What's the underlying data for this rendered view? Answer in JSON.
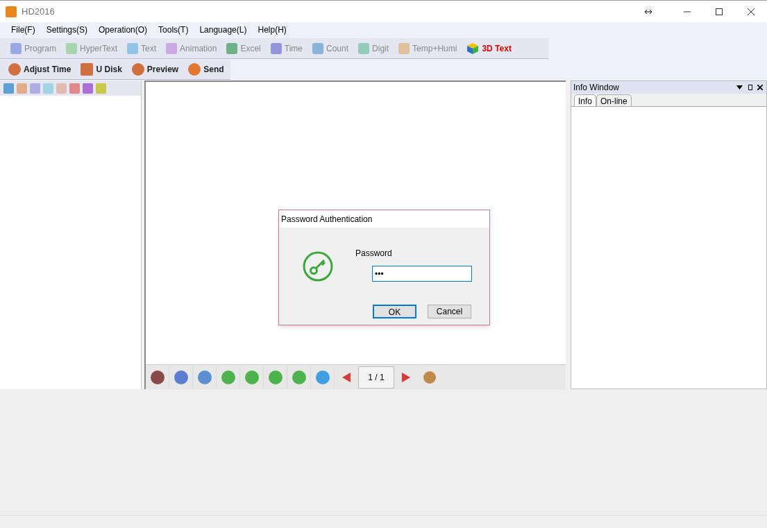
{
  "window": {
    "title": "HD2016"
  },
  "menu": [
    "File(F)",
    "Settings(S)",
    "Operation(O)",
    "Tools(T)",
    "Language(L)",
    "Help(H)"
  ],
  "toolbar_1": [
    {
      "label": "Program",
      "disabled": true
    },
    {
      "label": "HyperText",
      "disabled": true
    },
    {
      "label": "Text",
      "disabled": true
    },
    {
      "label": "Animation",
      "disabled": true
    },
    {
      "label": "Excel",
      "disabled": true
    },
    {
      "label": "Time",
      "disabled": true
    },
    {
      "label": "Count",
      "disabled": true
    },
    {
      "label": "Digit",
      "disabled": true
    },
    {
      "label": "Temp+Humi",
      "disabled": true
    },
    {
      "label": "3D Text",
      "disabled": false
    }
  ],
  "toolbar_2": [
    {
      "label": "Adjust Time"
    },
    {
      "label": "U Disk"
    },
    {
      "label": "Preview"
    },
    {
      "label": "Send"
    }
  ],
  "canvas_toolbar": {
    "page": "1 / 1"
  },
  "info_window": {
    "title": "Info Window",
    "tabs": [
      {
        "label": "Info",
        "selected": true
      },
      {
        "label": "On-line",
        "selected": false
      }
    ]
  },
  "dialog": {
    "title": "Password Authentication",
    "field_label": "Password",
    "value": "•••",
    "buttons": [
      {
        "label": "OK",
        "default": true
      },
      {
        "label": "Cancel",
        "default": false
      }
    ]
  }
}
